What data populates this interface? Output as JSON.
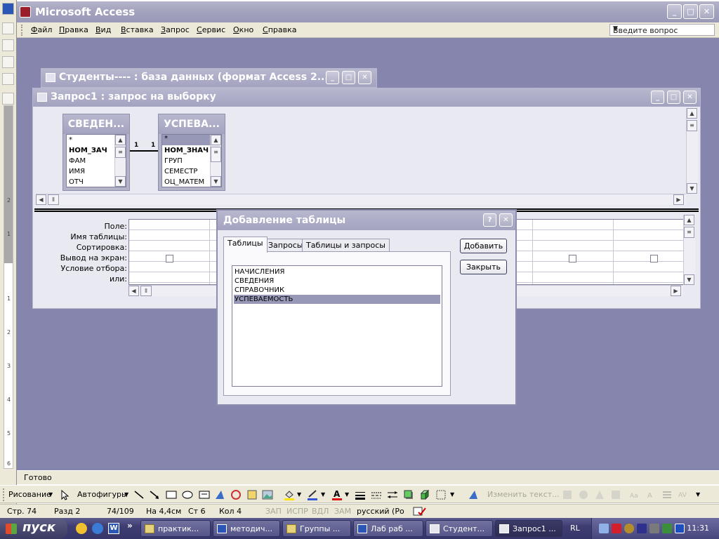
{
  "access": {
    "title": "Microsoft Access",
    "menu": [
      "Файл",
      "Правка",
      "Вид",
      "Вставка",
      "Запрос",
      "Сервис",
      "Окно",
      "Справка"
    ],
    "ask_placeholder": "Введите вопрос",
    "status": "Готово"
  },
  "db_window": {
    "title": "Студенты---- : база данных (формат Access 2..."
  },
  "query_window": {
    "title": "Запрос1 : запрос на выборку",
    "tables": [
      {
        "name": "СВЕДЕН...",
        "fields": [
          "*",
          "НОМ_ЗАЧ",
          "ФАМ",
          "ИМЯ",
          "ОТЧ"
        ]
      },
      {
        "name": "УСПЕВА...",
        "fields": [
          "*",
          "НОМ_ЗНАЧ",
          "ГРУП",
          "СЕМЕСТР",
          "ОЦ_МАТЕМ"
        ]
      }
    ],
    "relation": {
      "left": "1",
      "right": "1"
    },
    "grid_rows": [
      "Поле:",
      "Имя таблицы:",
      "Сортировка:",
      "Вывод на экран:",
      "Условие отбора:",
      "или:"
    ]
  },
  "dialog": {
    "title": "Добавление таблицы",
    "help": "?",
    "tabs": [
      "Таблицы",
      "Запросы",
      "Таблицы и запросы"
    ],
    "active_tab": "Таблицы",
    "items": [
      "НАЧИСЛЕНИЯ",
      "СВЕДЕНИЯ",
      "СПРАВОЧНИК",
      "УСПЕВАЕМОСТЬ"
    ],
    "selected": "УСПЕВАЕМОСТЬ",
    "add_label": "Добавить",
    "close_label": "Закрыть"
  },
  "drawbar": {
    "drawing": "Рисование",
    "autoshapes": "Автофигуры",
    "change_text": "Изменить текст..."
  },
  "word_status": {
    "page": "Стр. 74",
    "section": "Разд 2",
    "pages": "74/109",
    "at": "На 4,4см",
    "line": "Ст 6",
    "col": "Кол 4",
    "rec": "ЗАП",
    "trk": "ИСПР",
    "ext": "ВДЛ",
    "ovr": "ЗАМ",
    "lang": "русский (Ро"
  },
  "taskbar": {
    "start": "пуск",
    "tasks": [
      "практик...",
      "методич...",
      "Группы ...",
      "Лаб раб ...",
      "Студент...",
      "Запрос1 ..."
    ],
    "lang": "RL",
    "clock": "11:31"
  },
  "colors": {
    "mdi_bg": "#8585ad",
    "title_bar": "#a3a3c0",
    "selection": "#9797b8"
  }
}
